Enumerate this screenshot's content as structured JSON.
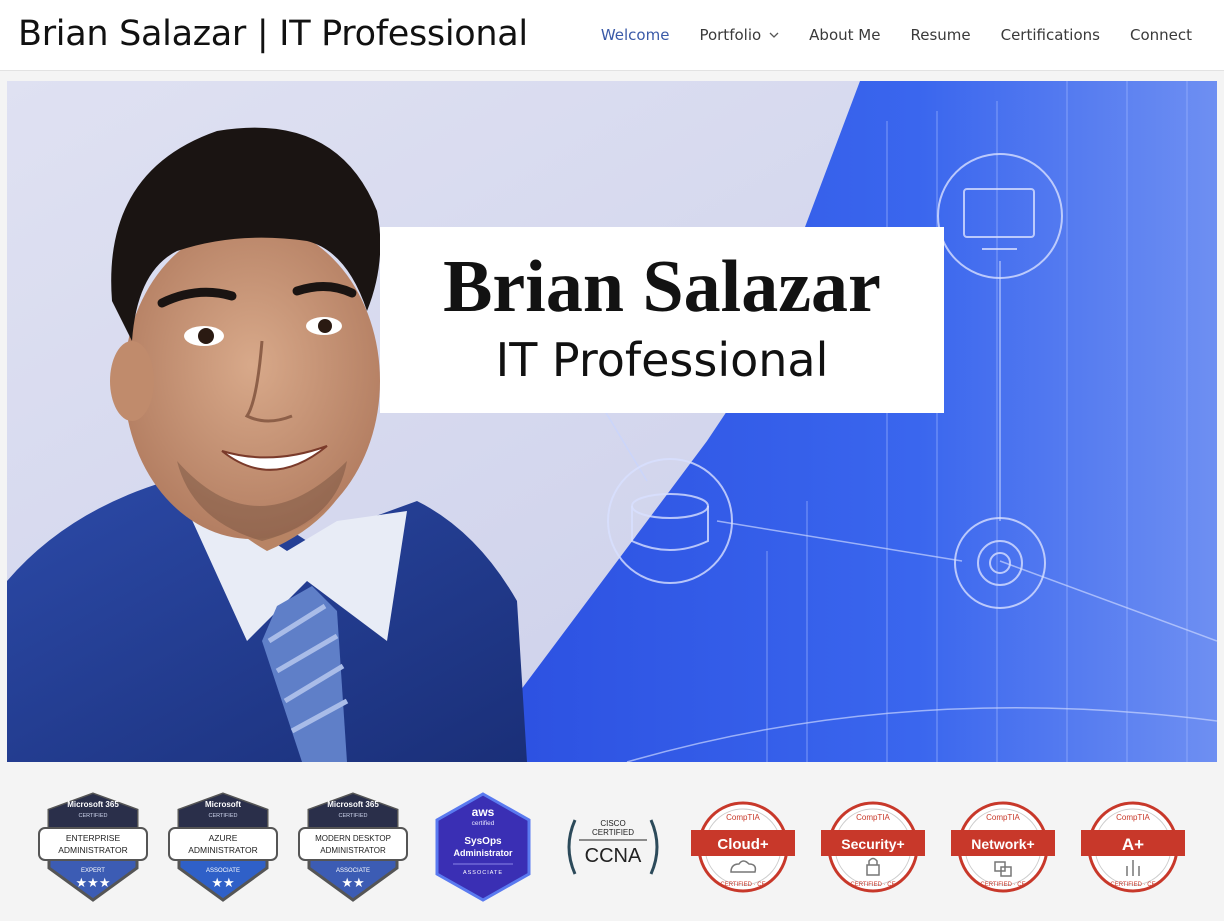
{
  "header": {
    "site_title": "Brian Salazar | IT Professional",
    "nav": [
      {
        "label": "Welcome",
        "active": true
      },
      {
        "label": "Portfolio",
        "has_dropdown": true
      },
      {
        "label": "About Me"
      },
      {
        "label": "Resume"
      },
      {
        "label": "Certifications"
      },
      {
        "label": "Connect"
      }
    ]
  },
  "hero": {
    "name": "Brian Salazar",
    "subtitle": "IT Professional"
  },
  "badges": [
    {
      "issuer": "Microsoft 365",
      "line2": "CERTIFIED",
      "title1": "ENTERPRISE",
      "title2": "ADMINISTRATOR",
      "level": "EXPERT",
      "stars": "★★★",
      "color": "#3c5cb4"
    },
    {
      "issuer": "Microsoft",
      "line2": "CERTIFIED",
      "title1": "AZURE",
      "title2": "ADMINISTRATOR",
      "level": "ASSOCIATE",
      "stars": "★★",
      "color": "#2f60c8"
    },
    {
      "issuer": "Microsoft 365",
      "line2": "CERTIFIED",
      "title1": "MODERN DESKTOP",
      "title2": "ADMINISTRATOR",
      "level": "ASSOCIATE",
      "stars": "★★",
      "color": "#3c5cb4"
    },
    {
      "issuer": "aws",
      "line2": "certified",
      "title1": "SysOps",
      "title2": "Administrator",
      "level": "ASSOCIATE",
      "color": "#3a2fb4"
    },
    {
      "issuer": "CISCO",
      "line2": "CERTIFIED",
      "title1": "CCNA"
    },
    {
      "issuer": "CompTIA",
      "title1": "Cloud+",
      "footer": "CERTIFIED · CE",
      "color": "#c8382a"
    },
    {
      "issuer": "CompTIA",
      "title1": "Security+",
      "footer": "CERTIFIED · CE",
      "color": "#c8382a"
    },
    {
      "issuer": "CompTIA",
      "title1": "Network+",
      "footer": "CERTIFIED · CE",
      "color": "#c8382a"
    },
    {
      "issuer": "CompTIA",
      "title1": "A+",
      "footer": "CERTIFIED · CE",
      "color": "#c8382a"
    }
  ]
}
